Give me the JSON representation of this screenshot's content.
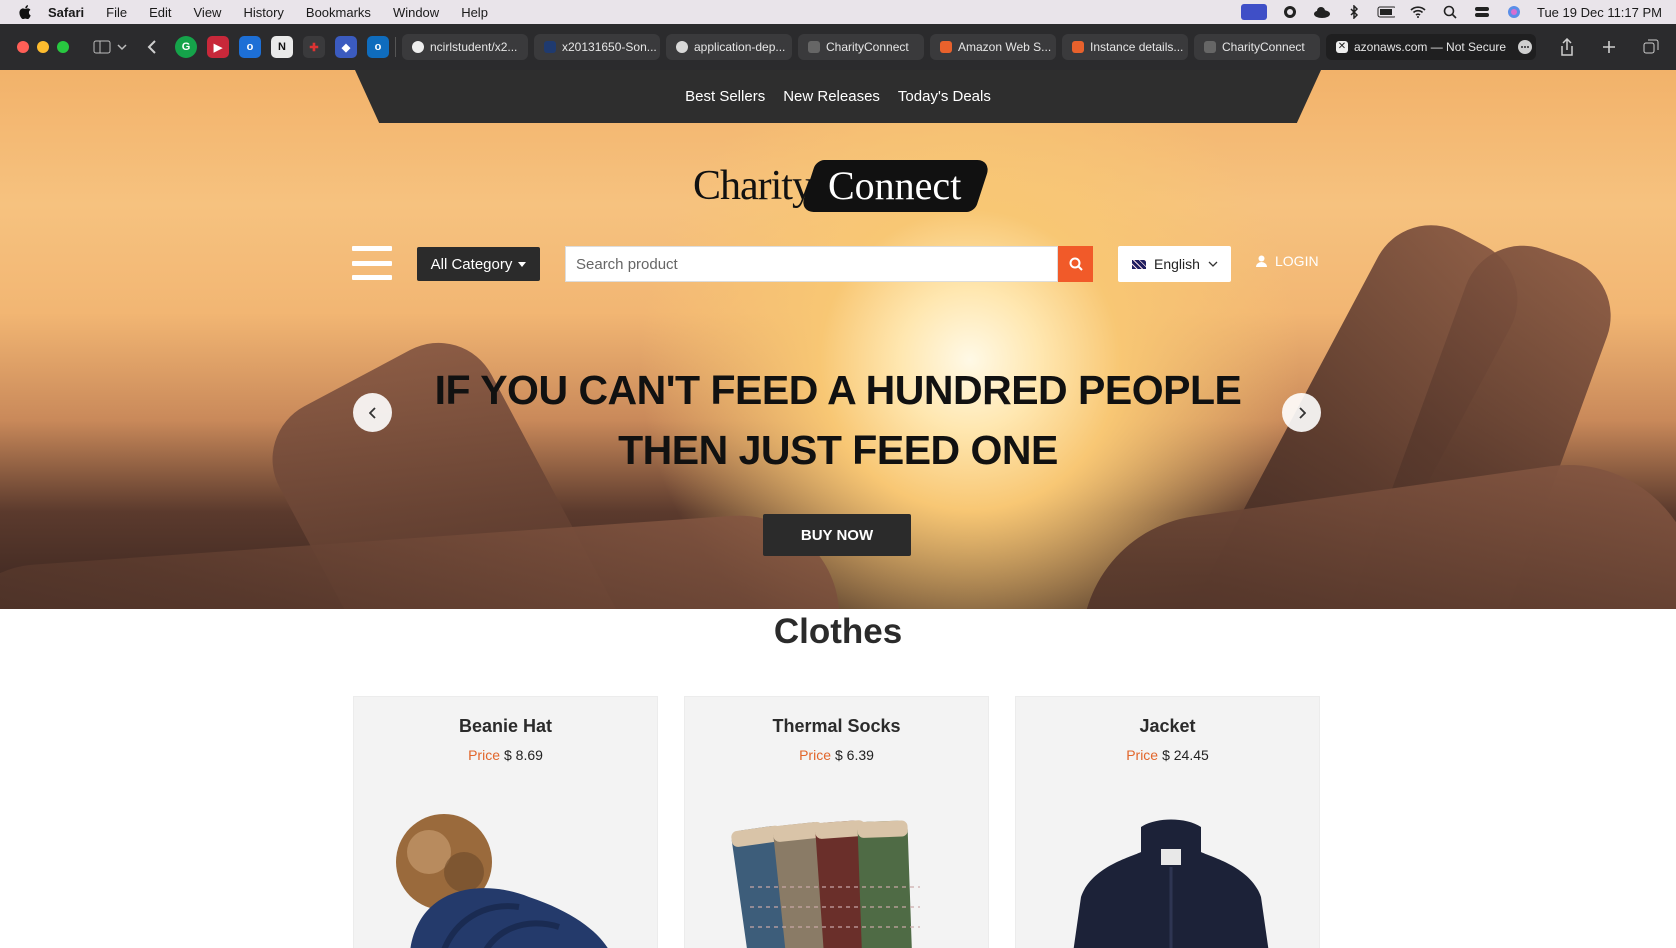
{
  "menubar": {
    "app_name": "Safari",
    "items": [
      "File",
      "Edit",
      "View",
      "History",
      "Bookmarks",
      "Window",
      "Help"
    ],
    "clock": "Tue 19 Dec  11:17 PM"
  },
  "browser": {
    "tabs": [
      {
        "label": "ncirlstudent/x2..."
      },
      {
        "label": "x20131650-Son..."
      },
      {
        "label": "application-dep..."
      },
      {
        "label": "CharityConnect"
      },
      {
        "label": "Amazon Web S..."
      },
      {
        "label": "Instance details..."
      },
      {
        "label": "CharityConnect"
      },
      {
        "label": "azonaws.com — Not Secure"
      }
    ]
  },
  "site": {
    "nav": [
      "Best Sellers",
      "New Releases",
      "Today's Deals"
    ],
    "logo": {
      "part1": "Charity",
      "part2": "Connect"
    },
    "category_button": "All Category",
    "search_placeholder": "Search product",
    "language": "English",
    "login": "LOGIN",
    "hero": {
      "line1": "IF YOU CAN'T FEED A HUNDRED PEOPLE",
      "line2": "THEN JUST FEED ONE",
      "cta": "BUY NOW"
    },
    "section_title": "Clothes",
    "price_label": "Price",
    "products": [
      {
        "name": "Beanie Hat",
        "price": "$ 8.69"
      },
      {
        "name": "Thermal Socks",
        "price": "$ 6.39"
      },
      {
        "name": "Jacket",
        "price": "$ 24.45"
      }
    ]
  },
  "colors": {
    "accent": "#f15a29",
    "price_label": "#e2662b",
    "dark": "#2b2b2b"
  }
}
